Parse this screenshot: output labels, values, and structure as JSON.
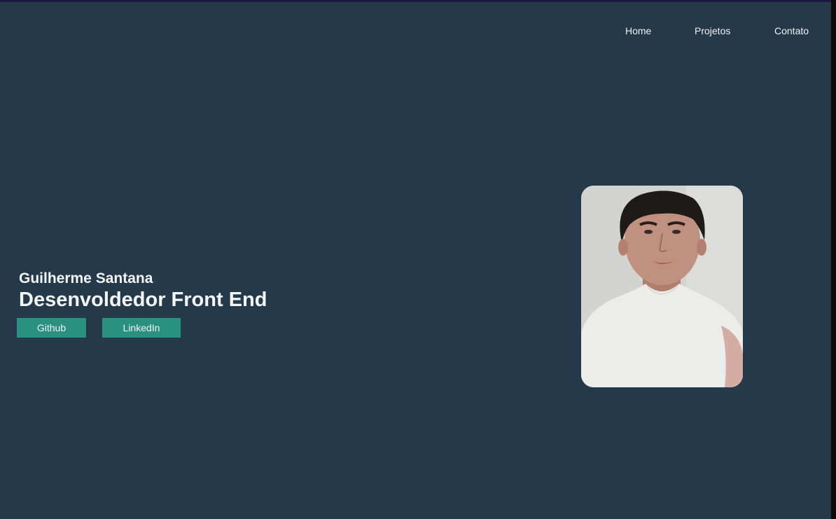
{
  "nav": {
    "items": [
      {
        "label": "Home"
      },
      {
        "label": "Projetos"
      },
      {
        "label": "Contato"
      }
    ]
  },
  "hero": {
    "name": "Guilherme Santana",
    "role": "Desenvoldedor Front End",
    "buttons": {
      "github_label": "Github",
      "linkedin_label": "LinkedIn"
    }
  },
  "colors": {
    "background": "#243a4a",
    "button": "#2a9180",
    "text": "#f5f5f5"
  }
}
